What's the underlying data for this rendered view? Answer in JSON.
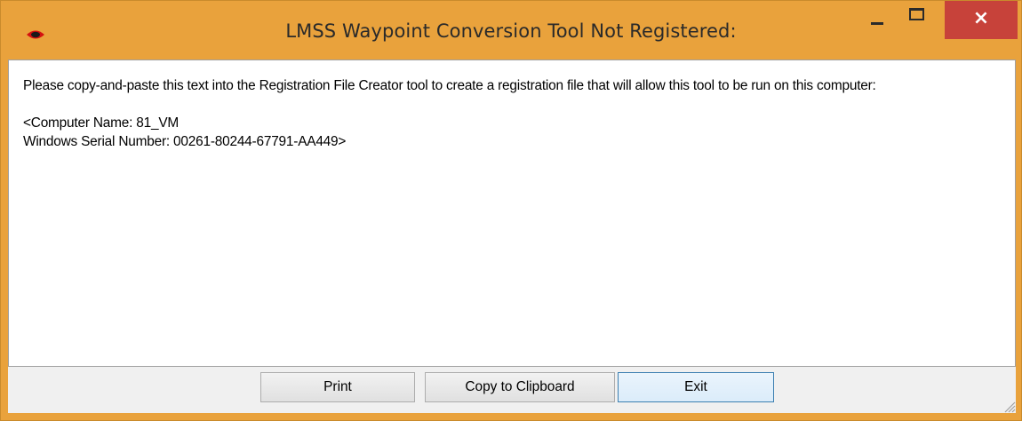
{
  "window": {
    "title": "LMSS Waypoint Conversion Tool Not Registered:",
    "close_glyph": "×",
    "icon": "app-eye-icon",
    "frame_color": "#e9a23c",
    "close_color": "#c7423a"
  },
  "message": {
    "intro": "Please copy-and-paste this text into the Registration File Creator tool to create a registration file that will allow this tool to be run on this computer:",
    "computer_name_line": "<Computer Name: 81_VM",
    "serial_line": "Windows Serial Number: 00261-80244-67791-AA449>"
  },
  "buttons": {
    "print_label": "Print",
    "copy_label": "Copy to Clipboard",
    "exit_label": "Exit"
  }
}
